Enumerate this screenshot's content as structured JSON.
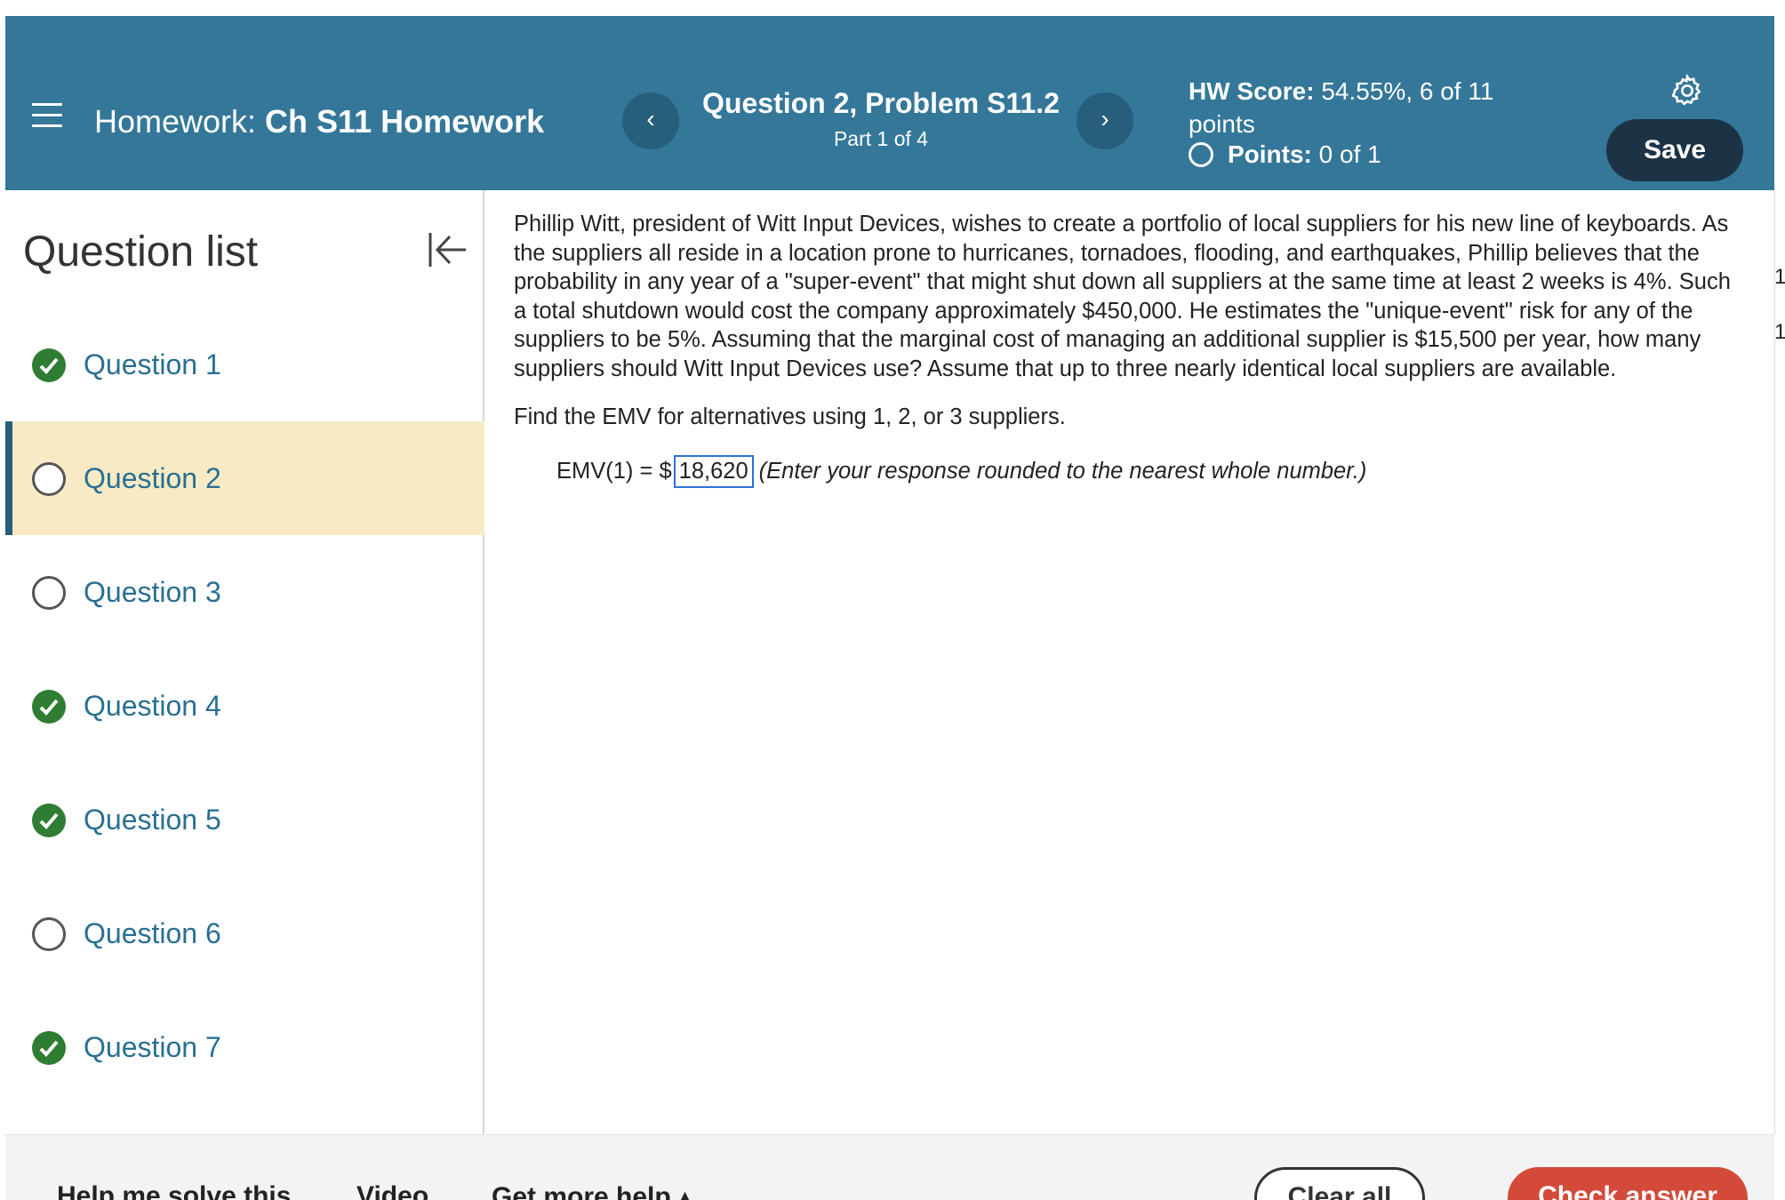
{
  "header": {
    "homework_prefix": "Homework:",
    "homework_name": "Ch S11 Homework",
    "question_title": "Question 2, Problem S11.2",
    "part": "Part 1 of 4",
    "hw_score_label": "HW Score:",
    "hw_score_value": "54.55%, 6 of 11",
    "hw_score_unit": "points",
    "points_label": "Points:",
    "points_value": "0 of 1",
    "save_label": "Save",
    "prev_symbol": "‹",
    "next_symbol": "›"
  },
  "sidebar": {
    "title": "Question list",
    "items": [
      {
        "label": "Question 1",
        "status": "done"
      },
      {
        "label": "Question 2",
        "status": "open",
        "active": true
      },
      {
        "label": "Question 3",
        "status": "open"
      },
      {
        "label": "Question 4",
        "status": "done"
      },
      {
        "label": "Question 5",
        "status": "done"
      },
      {
        "label": "Question 6",
        "status": "open"
      },
      {
        "label": "Question 7",
        "status": "done"
      }
    ]
  },
  "main": {
    "problem_text": "Phillip Witt, president of Witt Input Devices, wishes to create a portfolio of local suppliers for his new line of keyboards. As the suppliers all reside in a location prone to hurricanes, tornadoes, flooding, and earthquakes, Phillip believes that the probability in any year of a \"super-event\" that might shut down all suppliers at the same time at least 2 weeks is 4%. Such a total shutdown would cost the company approximately $450,000. He estimates the \"unique-event\" risk for any of the suppliers to be 5%. Assuming that the marginal cost of managing an additional supplier is $15,500 per year, how many suppliers should Witt Input Devices use? Assume that up to three nearly identical local suppliers are available.",
    "instruction": "Find the EMV for alternatives using 1, 2, or 3 suppliers.",
    "emv_label": "EMV(1) = $",
    "emv_value": "18,620",
    "emv_hint": "(Enter your response rounded to the nearest whole number.)"
  },
  "edge": {
    "num1": "1",
    "num2": "1"
  },
  "footer": {
    "help_label": "Help me solve this",
    "video_label": "Video",
    "more_help_label": "Get more help ▴",
    "clear_label": "Clear all",
    "check_label": "Check answer"
  },
  "colors": {
    "header_bg": "#347799",
    "save_bg": "#1c3346",
    "active_item_bg": "#f7eac5",
    "done_green": "#2e7d32",
    "link_blue": "#2a6f92",
    "check_red": "#d44a3a"
  }
}
